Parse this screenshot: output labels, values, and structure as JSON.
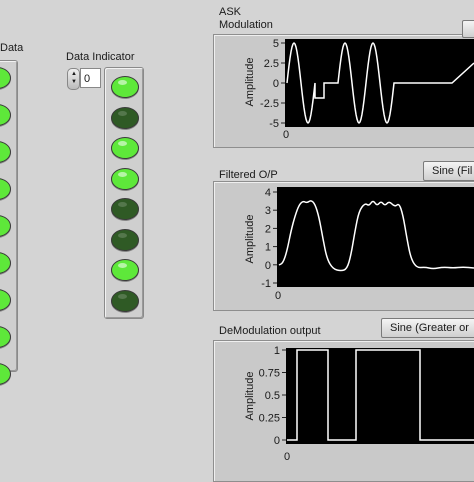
{
  "left_array": {
    "label": "Data"
  },
  "indicator": {
    "label": "Data Indicator",
    "index_value": "0",
    "led_states": [
      true,
      false,
      true,
      true,
      false,
      false,
      true,
      false
    ]
  },
  "left_strip_led_states": [
    true,
    true,
    true,
    true,
    true,
    true,
    true,
    true,
    true
  ],
  "colors": {
    "led_on": "#5ee83a",
    "led_off": "#2f5a25",
    "plot_bg": "#000000",
    "trace": "#ffffff",
    "panel": "#c9c9c9"
  },
  "graphs": [
    {
      "title_line1": "ASK",
      "title_line2": "Modulation",
      "ylabel": "Amplitude",
      "ticks": [
        "5",
        "2.5",
        "0",
        "-2.5",
        "-5"
      ],
      "xtick": "0",
      "legend_button": ""
    },
    {
      "title_line1": "Filtered O/P",
      "title_line2": "",
      "ylabel": "Amplitude",
      "ticks": [
        "4",
        "3",
        "2",
        "1",
        "0",
        "-1"
      ],
      "xtick": "0",
      "legend_button": "Sine (Fil"
    },
    {
      "title_line1": "DeModulation output",
      "title_line2": "",
      "ylabel": "Amplitude",
      "ticks": [
        "1",
        "0.75",
        "0.5",
        "0.25",
        "0"
      ],
      "xtick": "0",
      "legend_button": "Sine (Greater or"
    }
  ]
}
